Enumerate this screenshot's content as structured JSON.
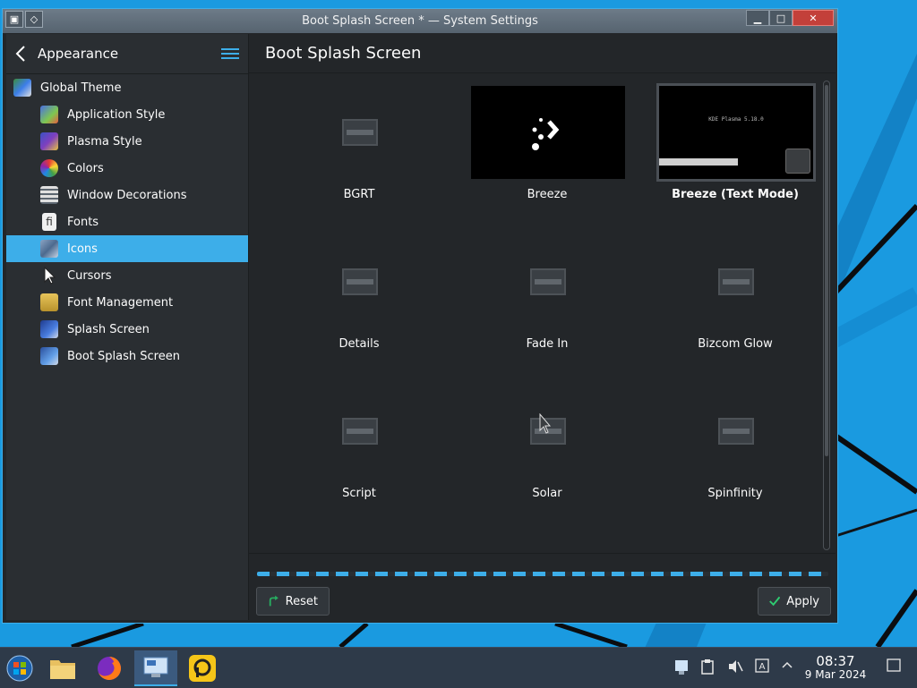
{
  "window": {
    "title": "Boot Splash Screen * — System Settings"
  },
  "sidebar": {
    "back_label": "Appearance",
    "items": [
      {
        "label": "Global Theme",
        "icon": "global-theme-icon"
      },
      {
        "label": "Application Style",
        "icon": "application-style-icon"
      },
      {
        "label": "Plasma Style",
        "icon": "plasma-style-icon"
      },
      {
        "label": "Colors",
        "icon": "colors-icon"
      },
      {
        "label": "Window Decorations",
        "icon": "window-decorations-icon"
      },
      {
        "label": "Fonts",
        "icon": "fonts-icon"
      },
      {
        "label": "Icons",
        "icon": "icons-icon",
        "active": true
      },
      {
        "label": "Cursors",
        "icon": "cursor-icon"
      },
      {
        "label": "Font Management",
        "icon": "font-management-icon"
      },
      {
        "label": "Splash Screen",
        "icon": "splash-screen-icon"
      },
      {
        "label": "Boot Splash Screen",
        "icon": "boot-splash-screen-icon"
      }
    ]
  },
  "main": {
    "title": "Boot Splash Screen",
    "themes": [
      {
        "label": "BGRT"
      },
      {
        "label": "Breeze"
      },
      {
        "label": "Breeze (Text Mode)",
        "selected": true,
        "preview_text": "KDE Plasma 5.18.0"
      },
      {
        "label": "Details"
      },
      {
        "label": "Fade In"
      },
      {
        "label": "Bizcom Glow"
      },
      {
        "label": "Script"
      },
      {
        "label": "Solar"
      },
      {
        "label": "Spinfinity"
      }
    ],
    "reset_label": "Reset",
    "apply_label": "Apply"
  },
  "taskbar": {
    "time": "08:37",
    "date": "9 Mar 2024"
  },
  "colors": {
    "accent": "#3daee9",
    "window_bg": "#232629",
    "sidebar_bg": "#2a2e32"
  }
}
